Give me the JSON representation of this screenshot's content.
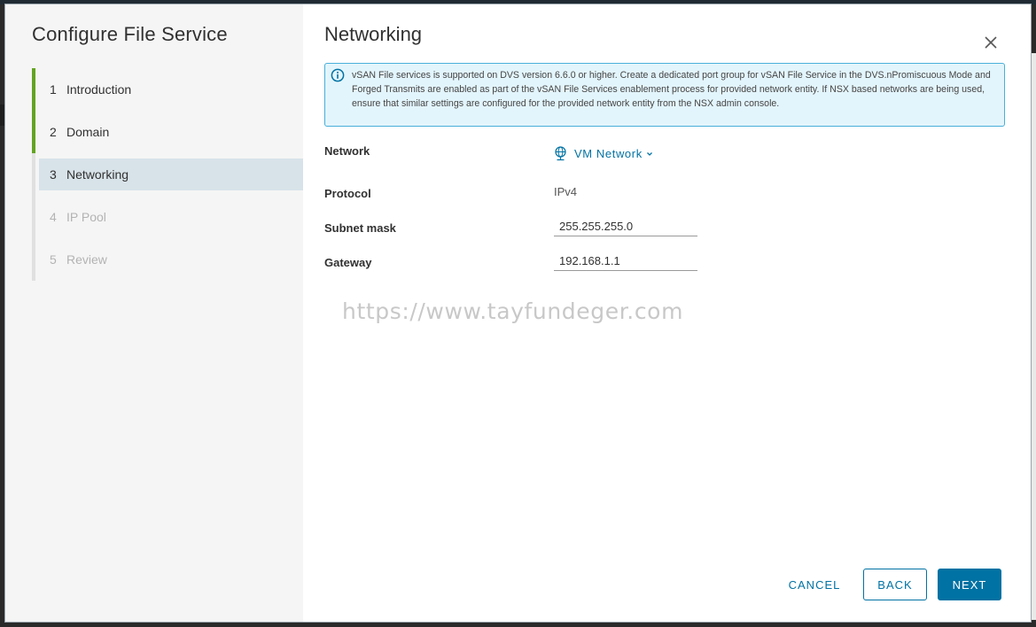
{
  "wizard": {
    "title": "Configure File Service",
    "steps": [
      {
        "num": "1",
        "label": "Introduction",
        "state": "done"
      },
      {
        "num": "2",
        "label": "Domain",
        "state": "done"
      },
      {
        "num": "3",
        "label": "Networking",
        "state": "active"
      },
      {
        "num": "4",
        "label": "IP Pool",
        "state": "disabled"
      },
      {
        "num": "5",
        "label": "Review",
        "state": "disabled"
      }
    ]
  },
  "page": {
    "title": "Networking",
    "info_message": "vSAN File services is supported on DVS version 6.6.0 or higher. Create a dedicated port group for vSAN File Service in the DVS.nPromiscuous Mode and Forged Transmits are enabled as part of the vSAN File Services enablement process for provided network entity. If NSX based networks are being used, ensure that similar settings are configured for the provided network entity from the NSX admin console."
  },
  "form": {
    "network_label": "Network",
    "network_value": "VM Network",
    "protocol_label": "Protocol",
    "protocol_value": "IPv4",
    "subnet_label": "Subnet mask",
    "subnet_value": "255.255.255.0",
    "gateway_label": "Gateway",
    "gateway_value": "192.168.1.1"
  },
  "watermark": "https://www.tayfundeger.com",
  "footer": {
    "cancel_label": "CANCEL",
    "back_label": "BACK",
    "next_label": "NEXT"
  },
  "icons": {
    "close": "close-icon",
    "info": "info-circle-icon",
    "network": "network-globe-icon",
    "dropdown": "chevron-down-icon"
  },
  "colors": {
    "accent": "#0072a3",
    "step_done": "#62a420",
    "active_step_bg": "#d8e3e9",
    "info_bg": "#e3f5fc",
    "info_border": "#49afd9"
  }
}
